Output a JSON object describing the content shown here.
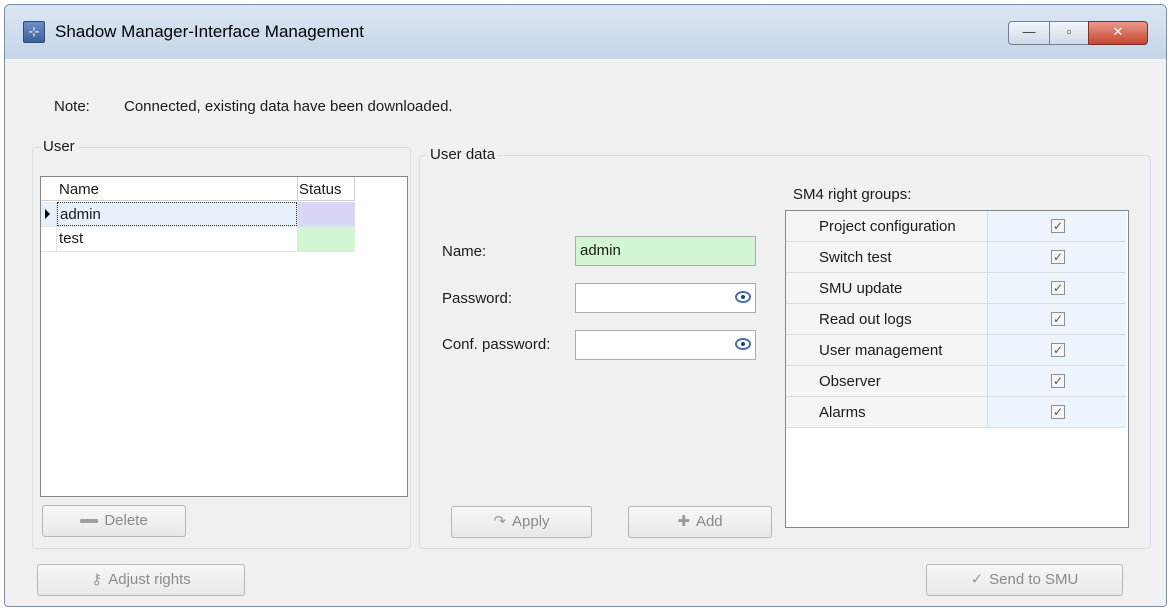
{
  "window": {
    "title": "Shadow Manager-Interface Management",
    "app_icon": "app-icon",
    "controls": {
      "minimize": "—",
      "maximize": "▫",
      "close": "✕"
    }
  },
  "note": {
    "label": "Note:",
    "text": "Connected, existing data have been downloaded."
  },
  "user_group": {
    "legend": "User",
    "columns": {
      "name": "Name",
      "status": "Status"
    },
    "rows": [
      {
        "name": "admin",
        "status_color": "#d7d6f4",
        "selected": true
      },
      {
        "name": "test",
        "status_color": "#d2f5d2",
        "selected": false
      }
    ],
    "delete_label": "Delete",
    "delete_icon": "minus-icon"
  },
  "user_data": {
    "legend": "User data",
    "name_label": "Name:",
    "name_value": "admin",
    "password_label": "Password:",
    "password_value": "",
    "conf_password_label": "Conf. password:",
    "conf_password_value": "",
    "apply_label": "Apply",
    "add_label": "Add"
  },
  "rights": {
    "label": "SM4 right groups:",
    "items": [
      {
        "name": "Project configuration",
        "checked": true
      },
      {
        "name": "Switch test",
        "checked": true
      },
      {
        "name": "SMU update",
        "checked": true
      },
      {
        "name": "Read out logs",
        "checked": true
      },
      {
        "name": "User management",
        "checked": true
      },
      {
        "name": "Observer",
        "checked": true
      },
      {
        "name": "Alarms",
        "checked": true
      }
    ]
  },
  "footer": {
    "adjust_rights_label": "Adjust rights",
    "send_label": "Send to SMU"
  },
  "colors": {
    "selected_row": "#e5f0f8",
    "name_field_bg": "#d2f5d2",
    "close_button": "#c7462f"
  }
}
